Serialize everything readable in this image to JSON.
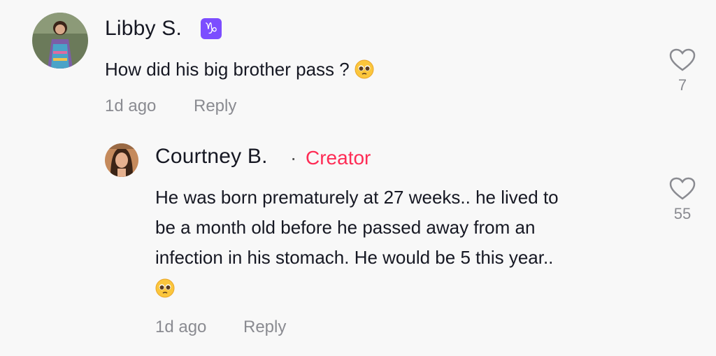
{
  "comments": [
    {
      "author": "Libby S.",
      "badge_icon": "capricorn-icon",
      "text": "How did his big brother pass ?",
      "emoji": "pleading-face-icon",
      "time": "1d ago",
      "reply_label": "Reply",
      "likes": "7"
    }
  ],
  "replies": [
    {
      "author": "Courtney B.",
      "separator": "·",
      "role": "Creator",
      "text_lines": [
        "He was born prematurely at 27 weeks.. he lived to",
        "be a month old before he passed away from an",
        "infection in his stomach. He would be 5 this year.."
      ],
      "emoji": "pleading-face-icon",
      "time": "1d ago",
      "reply_label": "Reply",
      "likes": "55"
    }
  ],
  "colors": {
    "background": "#f8f8f8",
    "creator": "#fe2c55",
    "muted": "#8a8b91",
    "badge": "#7c4dff"
  }
}
